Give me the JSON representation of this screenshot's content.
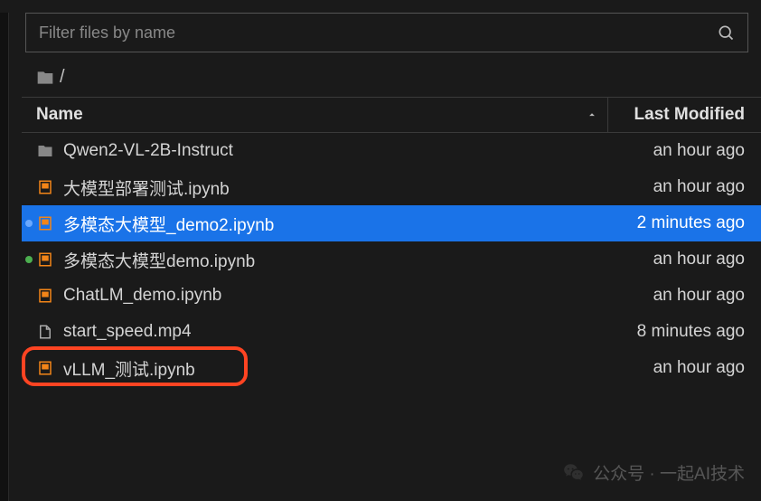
{
  "filter": {
    "placeholder": "Filter files by name"
  },
  "breadcrumb": {
    "path": "/"
  },
  "headers": {
    "name": "Name",
    "modified": "Last Modified"
  },
  "files": [
    {
      "name": "Qwen2-VL-2B-Instruct",
      "modified": "an hour ago",
      "type": "folder",
      "status": "",
      "selected": false
    },
    {
      "name": "大模型部署测试.ipynb",
      "modified": "an hour ago",
      "type": "notebook",
      "status": "",
      "selected": false
    },
    {
      "name": "多模态大模型_demo2.ipynb",
      "modified": "2 minutes ago",
      "type": "notebook",
      "status": "blue",
      "selected": true
    },
    {
      "name": "多模态大模型demo.ipynb",
      "modified": "an hour ago",
      "type": "notebook",
      "status": "green",
      "selected": false
    },
    {
      "name": "ChatLM_demo.ipynb",
      "modified": "an hour ago",
      "type": "notebook",
      "status": "",
      "selected": false
    },
    {
      "name": "start_speed.mp4",
      "modified": "8 minutes ago",
      "type": "file",
      "status": "",
      "selected": false
    },
    {
      "name": "vLLM_测试.ipynb",
      "modified": "an hour ago",
      "type": "notebook",
      "status": "",
      "selected": false
    }
  ],
  "watermark": {
    "text": "公众号 · 一起AI技术"
  },
  "icons": {
    "folder_color": "#888",
    "notebook_color": "#f38518",
    "file_color": "#aaa"
  }
}
